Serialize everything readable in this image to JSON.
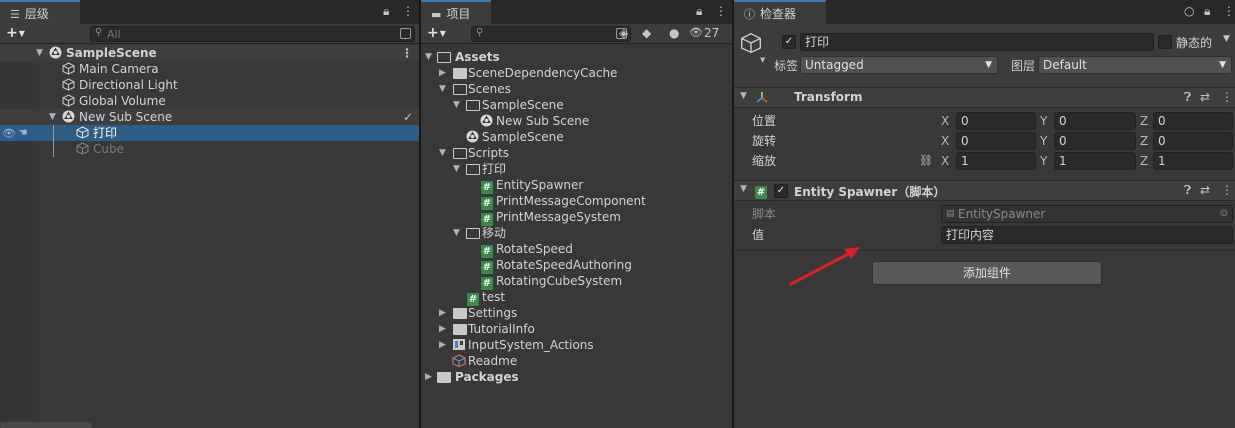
{
  "hierarchy": {
    "tab_label": "层级",
    "search_placeholder": "All",
    "scene_name": "SampleScene",
    "items": [
      {
        "label": "Main Camera"
      },
      {
        "label": "Directional Light"
      },
      {
        "label": "Global Volume"
      },
      {
        "label": "New Sub Scene"
      },
      {
        "label": "打印"
      },
      {
        "label": "Cube"
      }
    ]
  },
  "project": {
    "tab_label": "项目",
    "hidden_count": "27",
    "items": [
      {
        "label": "Assets"
      },
      {
        "label": "SceneDependencyCache"
      },
      {
        "label": "Scenes"
      },
      {
        "label": "SampleScene"
      },
      {
        "label": "New Sub Scene"
      },
      {
        "label": "SampleScene"
      },
      {
        "label": "Scripts"
      },
      {
        "label": "打印"
      },
      {
        "label": "EntitySpawner"
      },
      {
        "label": "PrintMessageComponent"
      },
      {
        "label": "PrintMessageSystem"
      },
      {
        "label": "移动"
      },
      {
        "label": "RotateSpeed"
      },
      {
        "label": "RotateSpeedAuthoring"
      },
      {
        "label": "RotatingCubeSystem"
      },
      {
        "label": "test"
      },
      {
        "label": "Settings"
      },
      {
        "label": "TutorialInfo"
      },
      {
        "label": "InputSystem_Actions"
      },
      {
        "label": "Readme"
      },
      {
        "label": "Packages"
      }
    ]
  },
  "inspector": {
    "tab_label": "检查器",
    "object_name": "打印",
    "static_label": "静态的",
    "tag_label": "标签",
    "tag_value": "Untagged",
    "layer_label": "图层",
    "layer_value": "Default",
    "transform": {
      "title": "Transform",
      "position_label": "位置",
      "rotation_label": "旋转",
      "scale_label": "缩放",
      "x": "X",
      "y": "Y",
      "z": "Z",
      "position": [
        "0",
        "0",
        "0"
      ],
      "rotation": [
        "0",
        "0",
        "0"
      ],
      "scale": [
        "1",
        "1",
        "1"
      ]
    },
    "entity_spawner": {
      "title": "Entity Spawner（脚本）",
      "script_label": "脚本",
      "script_value": "EntitySpawner",
      "value_label": "值",
      "value_value": "打印内容"
    },
    "add_component_label": "添加组件"
  },
  "colors": {
    "selection": "#2c5d87",
    "tab_accent": "#3a79bb",
    "script_icon": "#3a8b4a",
    "annotation_arrow": "#e02020"
  }
}
